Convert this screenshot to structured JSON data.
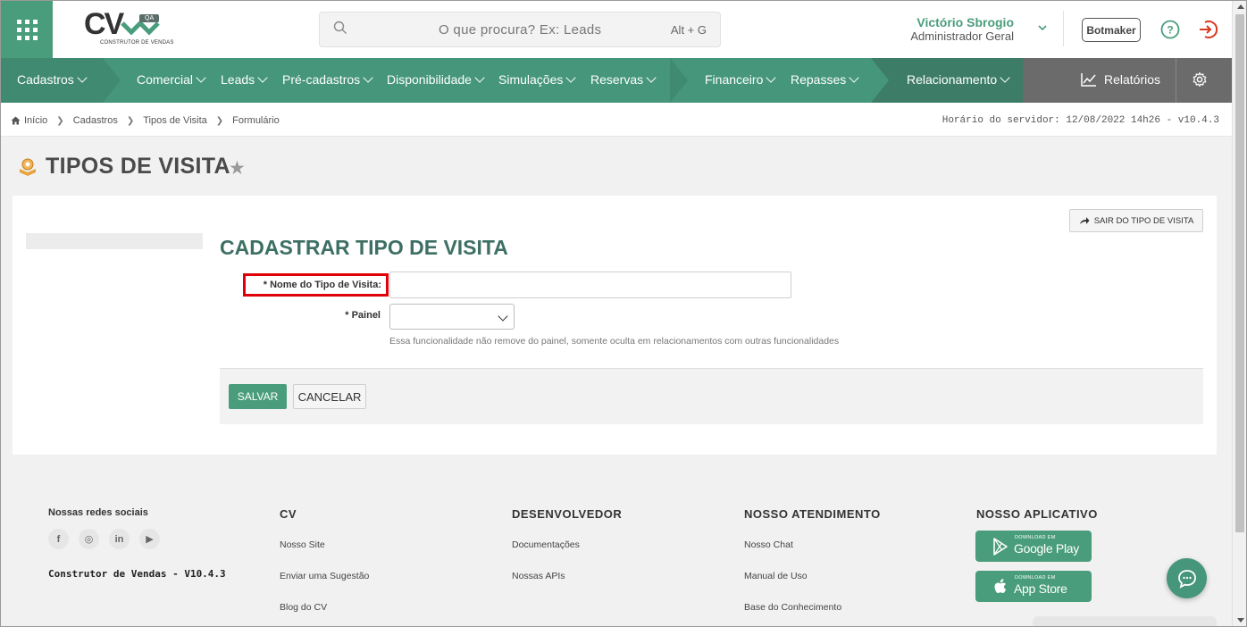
{
  "header": {
    "logo_text": "CV",
    "logo_badge": "QA",
    "logo_subtitle": "CONSTRUTOR DE VENDAS",
    "search_placeholder": "O que procura? Ex: Leads",
    "search_shortcut": "Alt + G",
    "user_name": "Victório Sbrogio",
    "user_role": "Administrador Geral",
    "botmaker_label": "Botmaker",
    "icons": [
      "apps-grid-icon",
      "search-icon",
      "chevron-down-icon",
      "help-icon",
      "logout-icon"
    ],
    "accent_color": "#4a9d7c"
  },
  "nav": {
    "items": [
      {
        "label": "Cadastros"
      },
      {
        "label": "Comercial"
      },
      {
        "label": "Leads"
      },
      {
        "label": "Pré-cadastros"
      },
      {
        "label": "Disponibilidade"
      },
      {
        "label": "Simulações"
      },
      {
        "label": "Reservas"
      },
      {
        "label": "Financeiro"
      },
      {
        "label": "Repasses"
      },
      {
        "label": "Relacionamento"
      }
    ],
    "reports_label": "Relatórios",
    "colors": {
      "primary": "#45967a",
      "dark": "#3d7d67",
      "reports_bg": "#6b6b6b"
    }
  },
  "breadcrumb": {
    "items": [
      "Início",
      "Cadastros",
      "Tipos de Visita",
      "Formulário"
    ],
    "server_time": "Horário do servidor: 12/08/2022 14h26 - v10.4.3"
  },
  "page": {
    "title": "TIPOS DE VISITA",
    "exit_button": "SAIR DO TIPO DE VISITA",
    "form_title": "CADASTRAR TIPO DE VISITA",
    "fields": {
      "name_label": "* Nome do Tipo de Visita:",
      "name_value": "",
      "painel_label": "* Painel",
      "painel_value": "",
      "painel_hint": "Essa funcionalidade não remove do painel, somente oculta em relacionamentos com outras funcionalidades"
    },
    "save_label": "SALVAR",
    "cancel_label": "CANCELAR",
    "highlight_color": "#e0000a"
  },
  "footer": {
    "social_title": "Nossas redes sociais",
    "social_icons": [
      "facebook-icon",
      "instagram-icon",
      "linkedin-icon",
      "youtube-icon"
    ],
    "social_glyphs": [
      "f",
      "◎",
      "in",
      "▶"
    ],
    "version": "Construtor de Vendas - V10.4.3",
    "cv": {
      "title": "CV",
      "links": [
        "Nosso Site",
        "Enviar uma Sugestão",
        "Blog do CV"
      ]
    },
    "dev": {
      "title": "DESENVOLVEDOR",
      "links": [
        "Documentações",
        "Nossas APIs"
      ]
    },
    "support": {
      "title": "NOSSO ATENDIMENTO",
      "links": [
        "Nosso Chat",
        "Manual de Uso",
        "Base do Conhecimento"
      ]
    },
    "app": {
      "title": "NOSSO APLICATIVO",
      "google_small": "DOWNLOAD EM",
      "google_big": "Google Play",
      "apple_small": "DOWNLOAD EM",
      "apple_big": "App Store"
    }
  }
}
